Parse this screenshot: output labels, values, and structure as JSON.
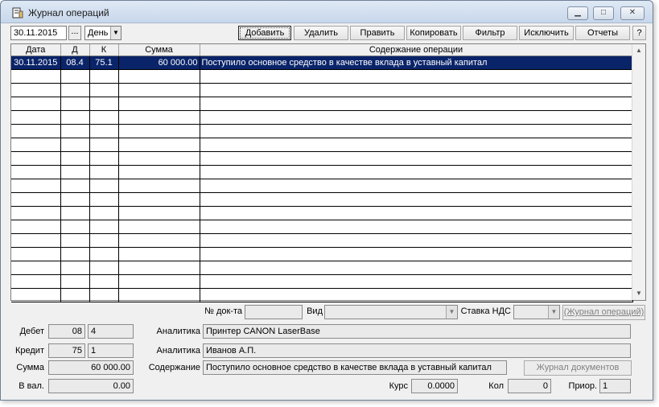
{
  "window": {
    "title": "Журнал операций",
    "icon": "journal-icon"
  },
  "toolbar": {
    "date": "30.11.2015",
    "date_picker": "...",
    "period": "День",
    "buttons": {
      "add": "Добавить",
      "delete": "Удалить",
      "edit": "Править",
      "copy": "Копировать",
      "filter": "Фильтр",
      "exclude": "Исключить",
      "reports": "Отчеты",
      "help": "?"
    }
  },
  "grid": {
    "columns": [
      "Дата",
      "Д",
      "К",
      "Сумма",
      "Содержание операции"
    ],
    "rows": [
      {
        "date": "30.11.2015",
        "debit": "08.4",
        "credit": "75.1",
        "amount": "60 000.00",
        "content": "Поступило основное средство в качестве вклада в уставный капитал",
        "selected": true
      }
    ],
    "empty_rows": 17
  },
  "details": {
    "doc_no_label": "№ док-та",
    "doc_no": "",
    "kind_label": "Вид",
    "kind": "",
    "vat_label": "Ставка НДС",
    "vat": "",
    "journal_ops_button": "(Журнал операций)",
    "debit_label": "Дебет",
    "debit_account": "08",
    "debit_sub": "4",
    "credit_label": "Кредит",
    "credit_account": "75",
    "credit_sub": "1",
    "sum_label": "Сумма",
    "sum": "60 000.00",
    "currency_label": "В вал.",
    "currency_sum": "0.00",
    "analytics_label_1": "Аналитика",
    "analytics_1": "Принтер CANON LaserBase",
    "analytics_label_2": "Аналитика",
    "analytics_2": "Иванов А.П.",
    "content_label": "Содержание",
    "content": "Поступило основное средство в качестве вклада в уставный капитал",
    "journal_docs_button": "Журнал документов",
    "rate_label": "Курс",
    "rate": "0.0000",
    "qty_label": "Кол",
    "qty": "0",
    "prior_label": "Приор.",
    "prior": "1"
  }
}
